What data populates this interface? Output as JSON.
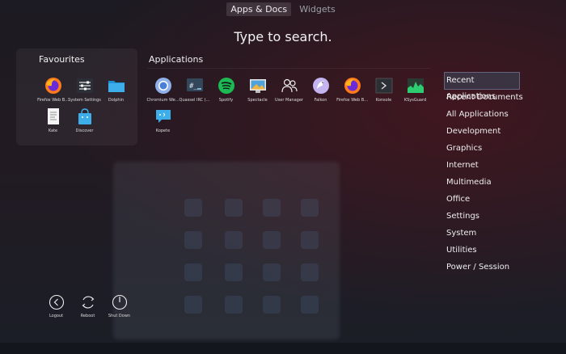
{
  "tabs": [
    {
      "label": "Apps & Docs",
      "active": true
    },
    {
      "label": "Widgets",
      "active": false
    }
  ],
  "search_prompt": "Type to search.",
  "favourites": {
    "title": "Favourites",
    "items": [
      {
        "label": "Firefox Web B...",
        "icon": "firefox-icon"
      },
      {
        "label": "System Settings",
        "icon": "settings-icon"
      },
      {
        "label": "Dolphin",
        "icon": "folder-icon"
      },
      {
        "label": "Kate",
        "icon": "text-editor-icon"
      },
      {
        "label": "Discover",
        "icon": "store-bag-icon"
      }
    ]
  },
  "applications": {
    "title": "Applications",
    "items": [
      {
        "label": "Chromium We...",
        "icon": "chromium-icon"
      },
      {
        "label": "Quassel IRC (...",
        "icon": "irc-icon"
      },
      {
        "label": "Spotify",
        "icon": "spotify-icon"
      },
      {
        "label": "Spectacle",
        "icon": "screenshot-icon"
      },
      {
        "label": "User Manager",
        "icon": "users-icon"
      },
      {
        "label": "Falkon",
        "icon": "falkon-icon"
      },
      {
        "label": "Firefox Web B...",
        "icon": "firefox-icon"
      },
      {
        "label": "Konsole",
        "icon": "terminal-icon"
      },
      {
        "label": "KSysGuard",
        "icon": "monitor-graph-icon"
      },
      {
        "label": "Kopete",
        "icon": "chat-icon"
      }
    ]
  },
  "categories": [
    {
      "label": "Recent Applications",
      "selected": true
    },
    {
      "label": "Recent Documents"
    },
    {
      "label": "All Applications"
    },
    {
      "label": "Development"
    },
    {
      "label": "Graphics"
    },
    {
      "label": "Internet"
    },
    {
      "label": "Multimedia"
    },
    {
      "label": "Office"
    },
    {
      "label": "Settings"
    },
    {
      "label": "System"
    },
    {
      "label": "Utilities"
    },
    {
      "label": "Power / Session"
    }
  ],
  "power": [
    {
      "label": "Logout",
      "icon": "logout-icon"
    },
    {
      "label": "Reboot",
      "icon": "reboot-icon"
    },
    {
      "label": "Shut Down",
      "icon": "power-icon"
    }
  ],
  "colors": {
    "selection": "#3c465a",
    "firefox_orange": "#ff7a1a",
    "spotify_green": "#1db954",
    "folder_blue": "#3daee9"
  }
}
